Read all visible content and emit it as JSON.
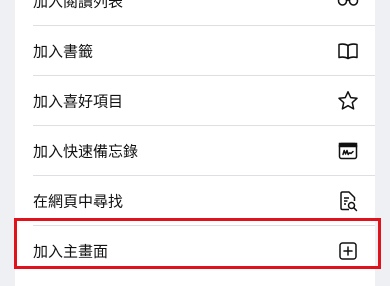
{
  "menu": {
    "items": [
      {
        "label": "加入閱讀列表",
        "icon": "glasses-icon"
      },
      {
        "label": "加入書籤",
        "icon": "book-icon"
      },
      {
        "label": "加入喜好項目",
        "icon": "star-icon"
      },
      {
        "label": "加入快速備忘錄",
        "icon": "quick-note-icon"
      },
      {
        "label": "在網頁中尋找",
        "icon": "find-in-page-icon"
      },
      {
        "label": "加入主畫面",
        "icon": "add-square-icon"
      }
    ]
  },
  "highlight": {
    "color": "#e0121b",
    "target": "加入主畫面"
  }
}
